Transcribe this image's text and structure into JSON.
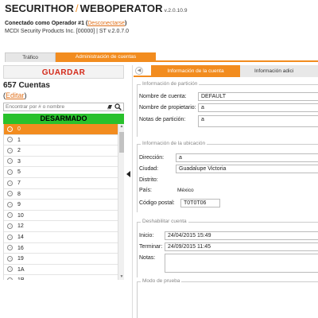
{
  "header": {
    "brand_left": "SECURITHOR",
    "brand_sep": "/",
    "brand_right": "WEBOPERATOR",
    "version": "v.2.0.10.9",
    "connected_prefix": "Conectado como Operador #1 (",
    "disconnect_label": "Desconectarse",
    "connected_suffix": ")",
    "product_line": "MCDI Security Products Inc. [00000] | ST v.2.0.7.0"
  },
  "tabs": [
    {
      "label": "Tráfico",
      "active": false
    },
    {
      "label": "Administración de cuentas",
      "active": true
    }
  ],
  "left": {
    "save_label": "GUARDAR",
    "count_label": "657 Cuentas",
    "edit_open": "(",
    "edit_label": "Editar",
    "edit_close": ")",
    "search_placeholder": "Encontrar por # o nombre",
    "status_label": "DESARMADO",
    "accounts": [
      "0",
      "1",
      "2",
      "3",
      "5",
      "7",
      "8",
      "9",
      "10",
      "12",
      "14",
      "16",
      "19",
      "1A",
      "1B"
    ],
    "selected_index": 0
  },
  "right": {
    "tabs": [
      {
        "label": "Información de la cuenta",
        "active": true
      },
      {
        "label": "Información adici",
        "active": false
      }
    ],
    "partition": {
      "legend": "Información de partición",
      "account_name_label": "Nombre de cuenta:",
      "account_name_value": "DEFAULT",
      "owner_label": "Nombre de propietario:",
      "owner_value": "a",
      "notes_label": "Notas de partición:",
      "notes_value": "a"
    },
    "location": {
      "legend": "Información de la ubicación",
      "address_label": "Dirección:",
      "address_value": "a",
      "city_label": "Ciudad:",
      "city_value": "Guadalupe Victoria",
      "district_label": "Distrito:",
      "district_value": "",
      "country_label": "País:",
      "country_value": "México",
      "postal_label": "Código postal:",
      "postal_value": "T0T0T06"
    },
    "disable": {
      "legend": "Deshabilitar cuenta",
      "start_label": "Inicio:",
      "start_value": "24/04/2015 15:49",
      "end_label": "Terminar:",
      "end_value": "24/09/2015 11:45",
      "notes_label": "Notas:",
      "notes_value": ""
    },
    "test_mode": {
      "legend": "Modo de prueba"
    }
  },
  "colors": {
    "accent": "#f28c1f",
    "save_text": "#d42a1a",
    "status_green": "#29c12c",
    "link": "#e0701a"
  }
}
